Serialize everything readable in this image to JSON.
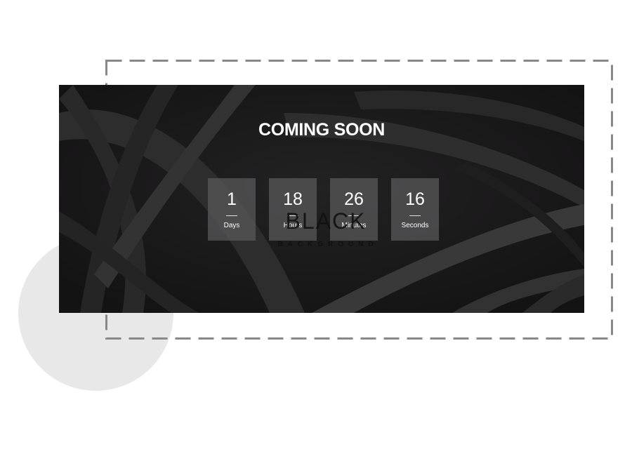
{
  "hero": {
    "title": "COMING SOON",
    "background_color": "#1c1b1c"
  },
  "watermark": {
    "line1": "BLACK",
    "line2": "BACKGROUND"
  },
  "countdown": [
    {
      "value": "1",
      "label": "Days"
    },
    {
      "value": "18",
      "label": "Hours"
    },
    {
      "value": "26",
      "label": "Minutes"
    },
    {
      "value": "16",
      "label": "Seconds"
    }
  ],
  "decor": {
    "circle_color": "#e8e8e8",
    "frame_color": "#888888"
  }
}
